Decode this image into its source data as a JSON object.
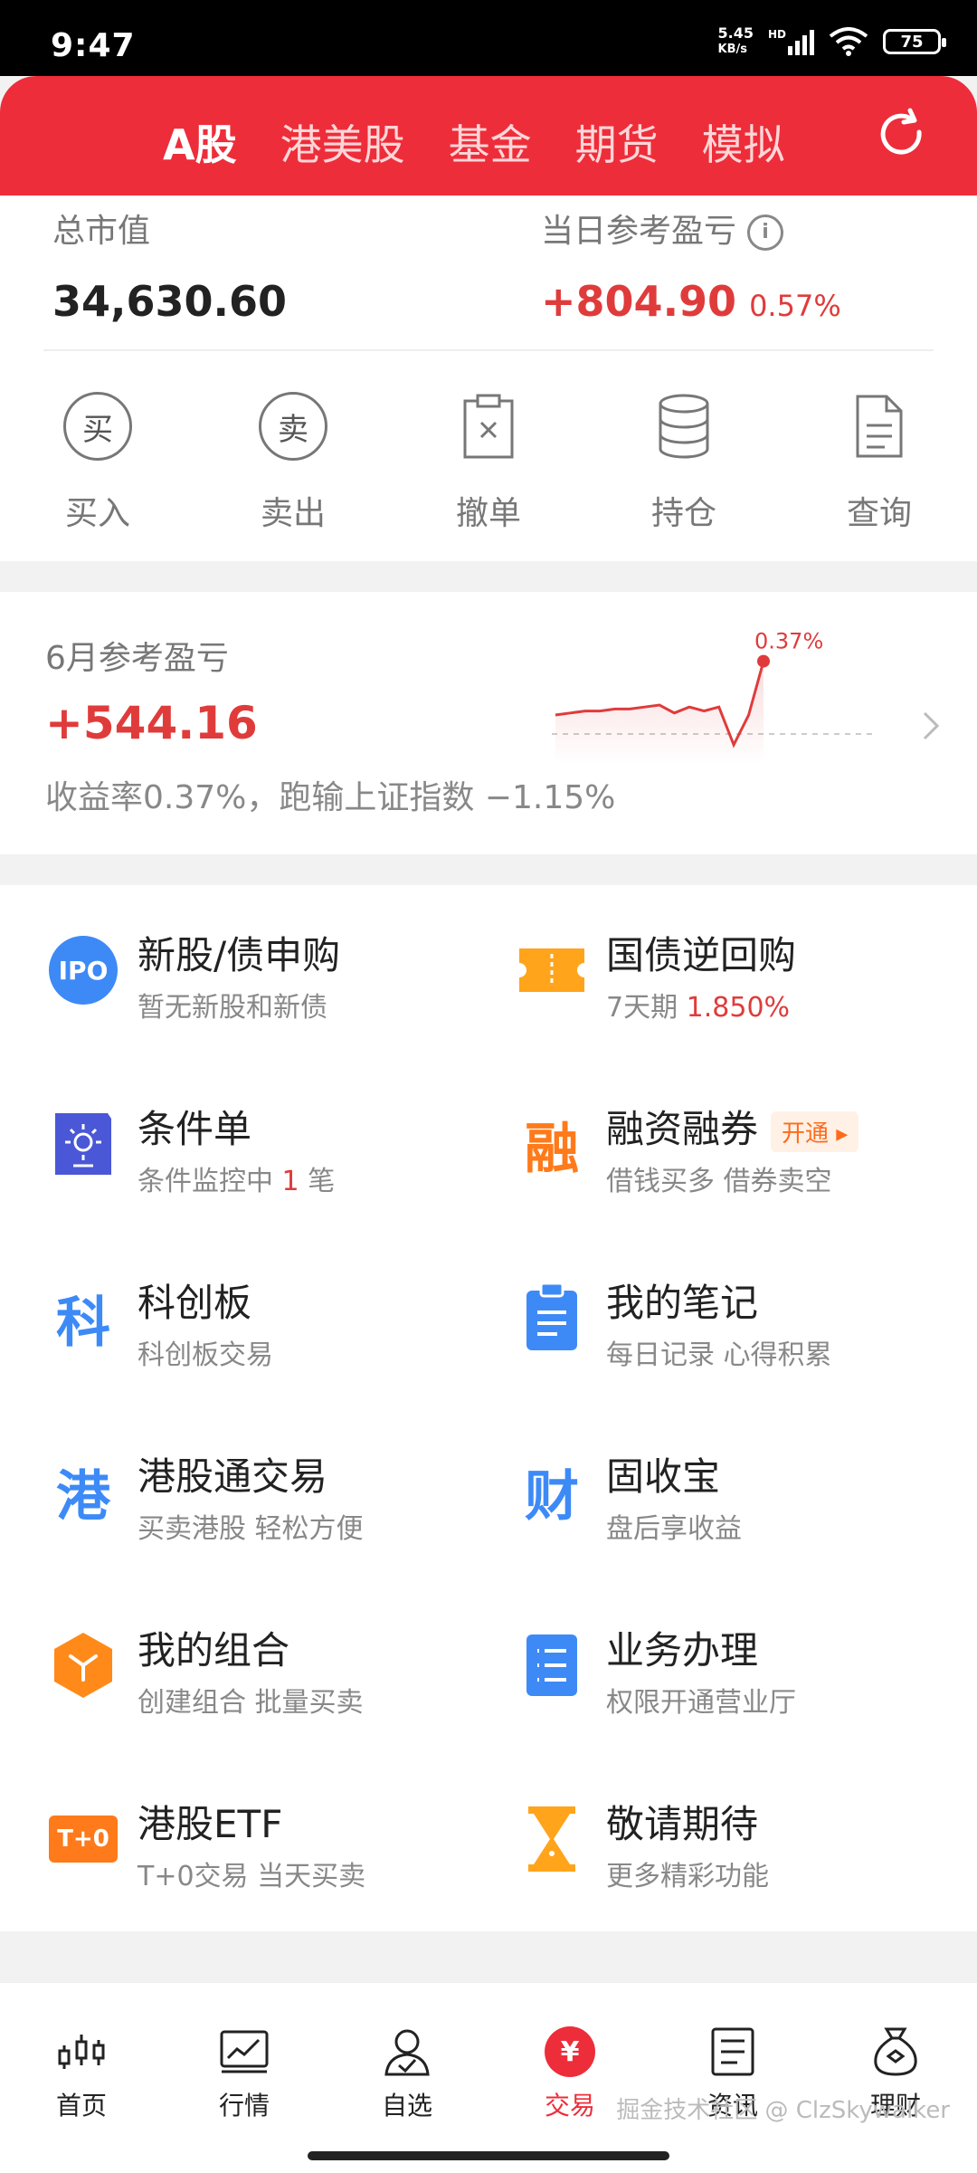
{
  "status_bar": {
    "time": "9:47",
    "speed_value": "5.45",
    "speed_unit": "KB/s",
    "network": "HD",
    "battery": "75"
  },
  "top_tabs": [
    {
      "label": "A股",
      "active": true
    },
    {
      "label": "港美股",
      "active": false
    },
    {
      "label": "基金",
      "active": false
    },
    {
      "label": "期货",
      "active": false
    },
    {
      "label": "模拟",
      "active": false
    }
  ],
  "summary": {
    "total_label": "总市值",
    "total_value": "34,630.60",
    "daily_label": "当日参考盈亏",
    "daily_value": "+804.90",
    "daily_pct": "0.57%"
  },
  "actions": [
    {
      "label": "买入",
      "icon_char": "买"
    },
    {
      "label": "卖出",
      "icon_char": "卖"
    },
    {
      "label": "撤单"
    },
    {
      "label": "持仓"
    },
    {
      "label": "查询"
    }
  ],
  "monthly": {
    "title": "6月参考盈亏",
    "value": "+544.16",
    "subtitle": "收益率0.37%，跑输上证指数 −1.15%",
    "chart_label": "0.37%"
  },
  "chart_data": {
    "type": "line",
    "series": [
      {
        "values": [
          0.1,
          0.11,
          0.12,
          0.12,
          0.13,
          0.13,
          0.14,
          0.15,
          0.11,
          0.14,
          0.12,
          0.14,
          -0.05,
          0.1,
          0.37
        ]
      }
    ],
    "ylim": [
      -0.1,
      0.4
    ],
    "end_label": "0.37%",
    "color": "#e03b3b"
  },
  "services": [
    {
      "title": "新股/债申购",
      "subtitle": "暂无新股和新债",
      "icon": "ipo-icon",
      "icon_text": "IPO"
    },
    {
      "title": "国债逆回购",
      "subtitle_prefix": "7天期",
      "subtitle_highlight": "1.850%",
      "icon": "ticket-icon"
    },
    {
      "title": "条件单",
      "subtitle_prefix": "条件监控中",
      "subtitle_highlight": "1",
      "subtitle_suffix": "笔",
      "icon": "condition-icon"
    },
    {
      "title": "融资融券",
      "badge": "开通",
      "subtitle": "借钱买多 借券卖空",
      "icon": "margin-icon",
      "icon_text": "融"
    },
    {
      "title": "科创板",
      "subtitle": "科创板交易",
      "icon": "star-market-icon",
      "icon_text": "科"
    },
    {
      "title": "我的笔记",
      "subtitle": "每日记录 心得积累",
      "icon": "notes-icon"
    },
    {
      "title": "港股通交易",
      "subtitle": "买卖港股 轻松方便",
      "icon": "hk-connect-icon",
      "icon_text": "港"
    },
    {
      "title": "固收宝",
      "subtitle": "盘后享收益",
      "icon": "fixed-income-icon",
      "icon_text": "财"
    },
    {
      "title": "我的组合",
      "subtitle": "创建组合 批量买卖",
      "icon": "portfolio-icon"
    },
    {
      "title": "业务办理",
      "subtitle": "权限开通营业厅",
      "icon": "business-icon"
    },
    {
      "title": "港股ETF",
      "subtitle": "T+0交易 当天买卖",
      "icon": "t0-icon",
      "icon_text": "T+0"
    },
    {
      "title": "敬请期待",
      "subtitle": "更多精彩功能",
      "icon": "hourglass-icon"
    }
  ],
  "bottom_nav": [
    {
      "label": "首页",
      "icon": "candlestick-icon"
    },
    {
      "label": "行情",
      "icon": "market-chart-icon"
    },
    {
      "label": "自选",
      "icon": "watchlist-icon"
    },
    {
      "label": "交易",
      "icon": "trade-yuan-icon",
      "active": true,
      "icon_text": "¥"
    },
    {
      "label": "资讯",
      "icon": "news-icon"
    },
    {
      "label": "理财",
      "icon": "wealth-bag-icon"
    }
  ],
  "watermark": "掘金技术社区 @ ClzSkywalker"
}
